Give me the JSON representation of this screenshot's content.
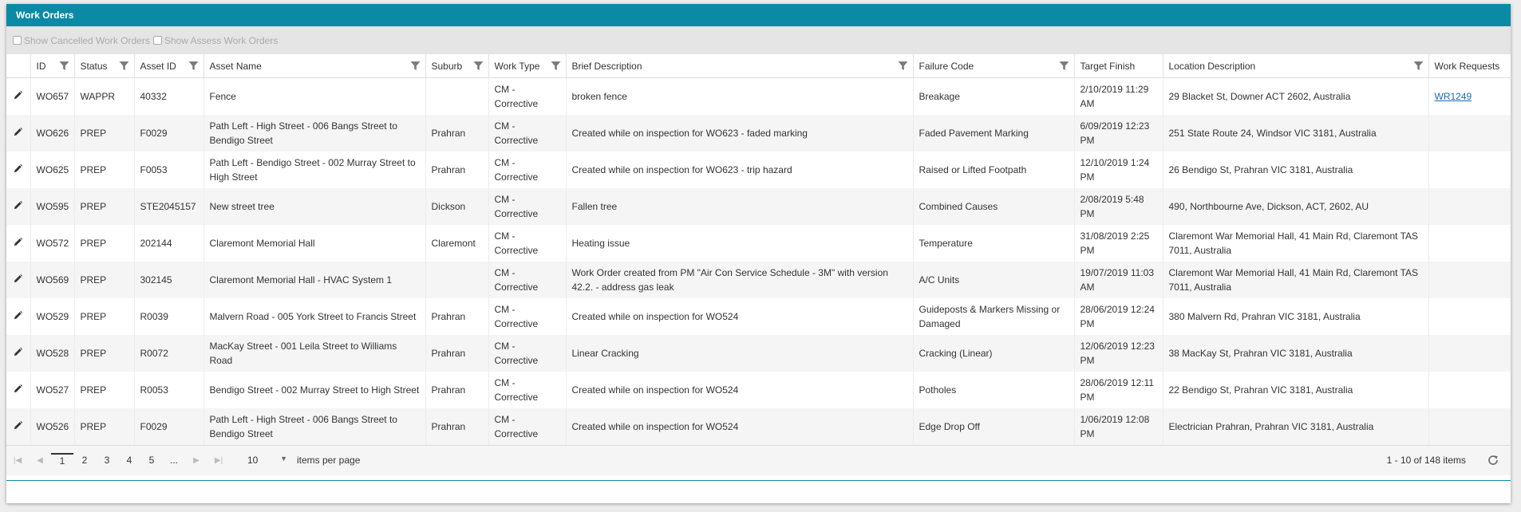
{
  "panel": {
    "title": "Work Orders"
  },
  "toolbar": {
    "show_cancelled": "Show Cancelled Work Orders",
    "show_assess": "Show Assess Work Orders"
  },
  "columns": [
    "ID",
    "Status",
    "Asset ID",
    "Asset Name",
    "Suburb",
    "Work Type",
    "Brief Description",
    "Failure Code",
    "Target Finish",
    "Location Description",
    "Work Requests"
  ],
  "rows": [
    [
      "WO657",
      "WAPPR",
      "40332",
      "Fence",
      "",
      "CM - Corrective",
      "broken fence",
      "Breakage",
      "2/10/2019 11:29 AM",
      "29 Blacket St, Downer ACT 2602, Australia",
      "WR1249"
    ],
    [
      "WO626",
      "PREP",
      "F0029",
      "Path Left - High Street - 006 Bangs Street to Bendigo Street",
      "Prahran",
      "CM - Corrective",
      "Created while on inspection for WO623 - faded marking",
      "Faded Pavement Marking",
      "6/09/2019 12:23 PM",
      "251 State Route 24, Windsor VIC 3181, Australia",
      ""
    ],
    [
      "WO625",
      "PREP",
      "F0053",
      "Path Left - Bendigo Street - 002 Murray Street to High Street",
      "Prahran",
      "CM - Corrective",
      "Created while on inspection for WO623 - trip hazard",
      "Raised or Lifted Footpath",
      "12/10/2019 1:24 PM",
      "26 Bendigo St, Prahran VIC 3181, Australia",
      ""
    ],
    [
      "WO595",
      "PREP",
      "STE2045157",
      "New street tree",
      "Dickson",
      "CM - Corrective",
      "Fallen tree",
      "Combined Causes",
      "2/08/2019 5:48 PM",
      "490, Northbourne Ave, Dickson, ACT, 2602, AU",
      ""
    ],
    [
      "WO572",
      "PREP",
      "202144",
      "Claremont Memorial Hall",
      "Claremont",
      "CM - Corrective",
      "Heating issue",
      "Temperature",
      "31/08/2019 2:25 PM",
      "Claremont War Memorial Hall, 41 Main Rd, Claremont TAS 7011, Australia",
      ""
    ],
    [
      "WO569",
      "PREP",
      "302145",
      "Claremont Memorial Hall - HVAC System 1",
      "",
      "CM - Corrective",
      "Work Order created from PM \"Air Con Service Schedule - 3M\" with version 42.2. - address gas leak",
      "A/C Units",
      "19/07/2019 11:03 AM",
      "Claremont War Memorial Hall, 41 Main Rd, Claremont TAS 7011, Australia",
      ""
    ],
    [
      "WO529",
      "PREP",
      "R0039",
      "Malvern Road - 005 York Street to Francis Street",
      "Prahran",
      "CM - Corrective",
      "Created while on inspection for WO524",
      "Guideposts & Markers Missing or Damaged",
      "28/06/2019 12:24 PM",
      "380 Malvern Rd, Prahran VIC 3181, Australia",
      ""
    ],
    [
      "WO528",
      "PREP",
      "R0072",
      "MacKay Street - 001 Leila Street to Williams Road",
      "Prahran",
      "CM - Corrective",
      "Linear Cracking",
      "Cracking (Linear)",
      "12/06/2019 12:23 PM",
      "38 MacKay St, Prahran VIC 3181, Australia",
      ""
    ],
    [
      "WO527",
      "PREP",
      "R0053",
      "Bendigo Street - 002 Murray Street to High Street",
      "Prahran",
      "CM - Corrective",
      "Created while on inspection for WO524",
      "Potholes",
      "28/06/2019 12:11 PM",
      "22 Bendigo St, Prahran VIC 3181, Australia",
      ""
    ],
    [
      "WO526",
      "PREP",
      "F0029",
      "Path Left - High Street - 006 Bangs Street to Bendigo Street",
      "Prahran",
      "CM - Corrective",
      "Created while on inspection for WO524",
      "Edge Drop Off",
      "1/06/2019 12:08 PM",
      "Electrician Prahran, Prahran VIC 3181, Australia",
      ""
    ]
  ],
  "pager": {
    "pages": [
      "1",
      "2",
      "3",
      "4",
      "5",
      "..."
    ],
    "page_size": "10",
    "items_per_page": "items per page",
    "range": "1 - 10 of 148 items"
  },
  "icons": {
    "edit": "pencil-icon",
    "filter": "filter-icon",
    "refresh": "refresh-icon"
  }
}
